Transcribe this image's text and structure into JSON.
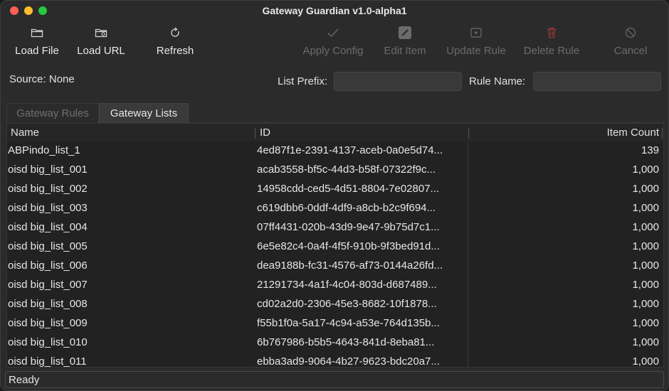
{
  "window": {
    "title": "Gateway Guardian v1.0-alpha1"
  },
  "toolbar": {
    "load_file": {
      "label": "Load File",
      "icon": "folder-icon",
      "enabled": true
    },
    "load_url": {
      "label": "Load URL",
      "icon": "folder-link-icon",
      "enabled": true
    },
    "refresh": {
      "label": "Refresh",
      "icon": "refresh-icon",
      "enabled": true
    },
    "apply_config": {
      "label": "Apply Config",
      "icon": "checkmark-icon",
      "enabled": false
    },
    "edit_item": {
      "label": "Edit Item",
      "icon": "edit-icon",
      "enabled": false
    },
    "update_rule": {
      "label": "Update Rule",
      "icon": "update-icon",
      "enabled": false
    },
    "delete_rule": {
      "label": "Delete Rule",
      "icon": "trash-icon",
      "enabled": false
    },
    "cancel": {
      "label": "Cancel",
      "icon": "cancel-icon",
      "enabled": false
    }
  },
  "source": {
    "label": "Source: None"
  },
  "fields": {
    "list_prefix": {
      "label": "List Prefix:",
      "value": "",
      "placeholder": ""
    },
    "rule_name": {
      "label": "Rule Name:",
      "value": "",
      "placeholder": ""
    }
  },
  "tabs": [
    {
      "label": "Gateway Rules",
      "active": false
    },
    {
      "label": "Gateway Lists",
      "active": true
    }
  ],
  "table": {
    "columns": {
      "name": "Name",
      "id": "ID",
      "count": "Item Count"
    },
    "rows": [
      {
        "name": "ABPindo_list_1",
        "id": "4ed87f1e-2391-4137-aceb-0a0e5d74...",
        "count": "139"
      },
      {
        "name": "oisd big_list_001",
        "id": "acab3558-bf5c-44d3-b58f-07322f9c...",
        "count": "1,000"
      },
      {
        "name": "oisd big_list_002",
        "id": "14958cdd-ced5-4d51-8804-7e02807...",
        "count": "1,000"
      },
      {
        "name": "oisd big_list_003",
        "id": "c619dbb6-0ddf-4df9-a8cb-b2c9f694...",
        "count": "1,000"
      },
      {
        "name": "oisd big_list_004",
        "id": "07ff4431-020b-43d9-9e47-9b75d7c1...",
        "count": "1,000"
      },
      {
        "name": "oisd big_list_005",
        "id": "6e5e82c4-0a4f-4f5f-910b-9f3bed91d...",
        "count": "1,000"
      },
      {
        "name": "oisd big_list_006",
        "id": "dea9188b-fc31-4576-af73-0144a26fd...",
        "count": "1,000"
      },
      {
        "name": "oisd big_list_007",
        "id": "21291734-4a1f-4c04-803d-d687489...",
        "count": "1,000"
      },
      {
        "name": "oisd big_list_008",
        "id": "cd02a2d0-2306-45e3-8682-10f1878...",
        "count": "1,000"
      },
      {
        "name": "oisd big_list_009",
        "id": "f55b1f0a-5a17-4c94-a53e-764d135b...",
        "count": "1,000"
      },
      {
        "name": "oisd big_list_010",
        "id": "6b767986-b5b5-4643-841d-8eba81...",
        "count": "1,000"
      },
      {
        "name": "oisd big_list_011",
        "id": "ebba3ad9-9064-4b27-9623-bdc20a7...",
        "count": "1,000"
      }
    ]
  },
  "status": {
    "text": "Ready"
  },
  "colors": {
    "window_bg": "#2b2b2b",
    "table_bg": "#222222",
    "disabled_text": "#6b6b6b",
    "close": "#ff5f57",
    "minimize": "#febc2e",
    "maximize": "#28c840"
  }
}
